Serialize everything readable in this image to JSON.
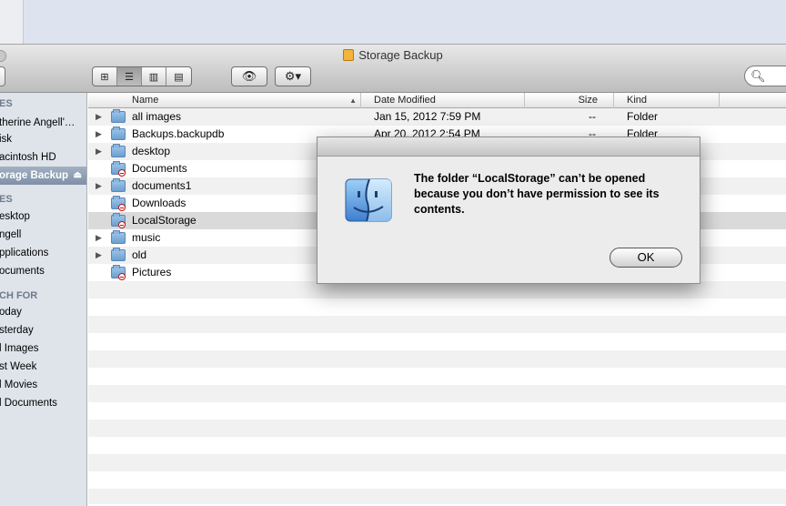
{
  "window": {
    "title": "Storage Backup"
  },
  "toolbar": {
    "view_modes": [
      "icon-view",
      "list-view",
      "column-view",
      "coverflow-view"
    ],
    "active_view": "list-view"
  },
  "sidebar": {
    "items": [
      {
        "label": "ES",
        "type": "header"
      },
      {
        "label": "therine Angell'…",
        "type": "item"
      },
      {
        "label": "isk",
        "type": "item"
      },
      {
        "label": "acintosh HD",
        "type": "item"
      },
      {
        "label": "orage Backup",
        "type": "item",
        "selected": true
      },
      {
        "label": "ES",
        "type": "header"
      },
      {
        "label": "esktop",
        "type": "item"
      },
      {
        "label": "ngell",
        "type": "item"
      },
      {
        "label": "pplications",
        "type": "item"
      },
      {
        "label": "ocuments",
        "type": "item"
      },
      {
        "label": "CH FOR",
        "type": "header"
      },
      {
        "label": "oday",
        "type": "item"
      },
      {
        "label": "sterday",
        "type": "item"
      },
      {
        "label": "l Images",
        "type": "item"
      },
      {
        "label": "st Week",
        "type": "item"
      },
      {
        "label": "l Movies",
        "type": "item"
      },
      {
        "label": "l Documents",
        "type": "item"
      }
    ]
  },
  "columns": {
    "name": "Name",
    "date": "Date Modified",
    "size": "Size",
    "kind": "Kind"
  },
  "files": [
    {
      "name": "all images",
      "date": "Jan 15, 2012 7:59 PM",
      "size": "--",
      "kind": "Folder",
      "expandable": true,
      "locked": false
    },
    {
      "name": "Backups.backupdb",
      "date": "Apr 20, 2012 2:54 PM",
      "size": "--",
      "kind": "Folder",
      "expandable": true,
      "locked": false
    },
    {
      "name": "desktop",
      "date": "",
      "size": "",
      "kind": "",
      "expandable": true,
      "locked": false
    },
    {
      "name": "Documents",
      "date": "",
      "size": "",
      "kind": "",
      "expandable": false,
      "locked": true
    },
    {
      "name": "documents1",
      "date": "",
      "size": "",
      "kind": "",
      "expandable": true,
      "locked": false
    },
    {
      "name": "Downloads",
      "date": "",
      "size": "",
      "kind": "",
      "expandable": false,
      "locked": true
    },
    {
      "name": "LocalStorage",
      "date": "",
      "size": "",
      "kind": "",
      "expandable": false,
      "locked": true,
      "selected": true
    },
    {
      "name": "music",
      "date": "",
      "size": "",
      "kind": "",
      "expandable": true,
      "locked": false
    },
    {
      "name": "old",
      "date": "",
      "size": "",
      "kind": "",
      "expandable": true,
      "locked": false
    },
    {
      "name": "Pictures",
      "date": "",
      "size": "",
      "kind": "",
      "expandable": false,
      "locked": true
    }
  ],
  "alert": {
    "message": "The folder “LocalStorage” can’t be opened because you don’t have permission to see its contents.",
    "ok_label": "OK",
    "icon": "finder-icon"
  }
}
